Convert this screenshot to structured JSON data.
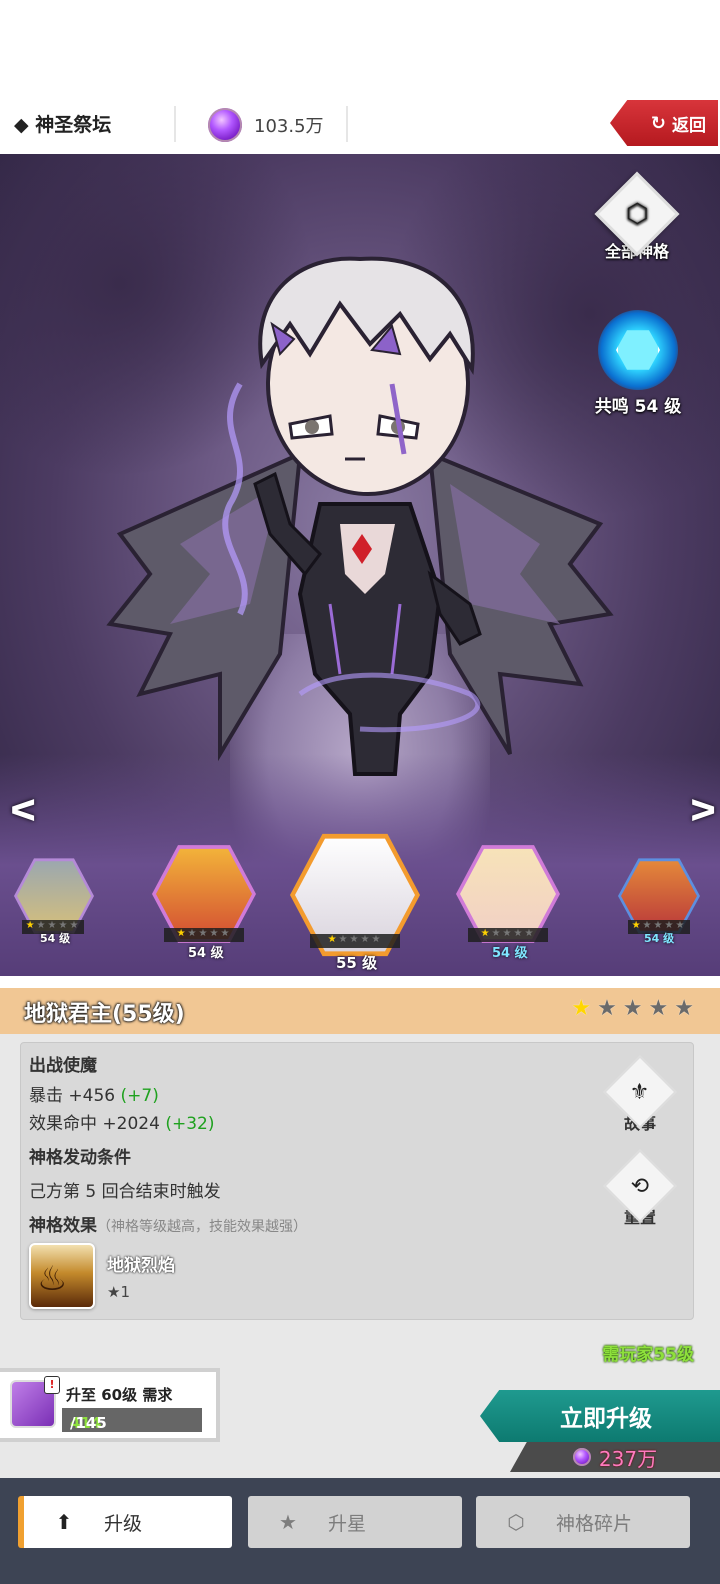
{
  "header": {
    "title": "◆ 神圣祭坛",
    "currency_value": "103.5万",
    "back_label": "返回",
    "back_icon": "↻"
  },
  "scene": {
    "all_gods_label": "全部神格",
    "resonance_label": "共鸣 54 级",
    "hexes": [
      {
        "level": "54 级",
        "stars": 1
      },
      {
        "level": "54 级",
        "stars": 1
      },
      {
        "level": "55 级",
        "stars": 1
      },
      {
        "level": "54 级",
        "stars": 1
      },
      {
        "level": "54 级",
        "stars": 1
      }
    ]
  },
  "hero": {
    "name": "地狱君主(55级)",
    "stars_filled": 1,
    "stars_total": 5
  },
  "info": {
    "section1_title": "出战使魔",
    "stat1_label": "暴击 +456",
    "stat1_bonus": "(+7)",
    "stat2_label": "效果命中 +2024",
    "stat2_bonus": "(+32)",
    "section2_title": "神格发动条件",
    "condition": "己方第 5 回合结束时触发",
    "section3_title": "神格效果",
    "section3_hint": "（神格等级越高，技能效果越强）",
    "effect_name": "地狱烈焰",
    "effect_star": "★1",
    "story_label": "故事",
    "reset_label": "重置"
  },
  "upgrade": {
    "need_player": "需玩家55级",
    "req_text": "升至 60级 需求",
    "have": "414",
    "need": "/145",
    "button": "立即升级",
    "cost": "237万"
  },
  "tabs": {
    "upgrade": "升级",
    "star": "升星",
    "fragment": "神格碎片"
  },
  "colors": {
    "back_red": "#c8262c",
    "upgrade_teal": "#168b80",
    "header_orange": "#f1c794",
    "bonus_green": "#1fa11f"
  }
}
